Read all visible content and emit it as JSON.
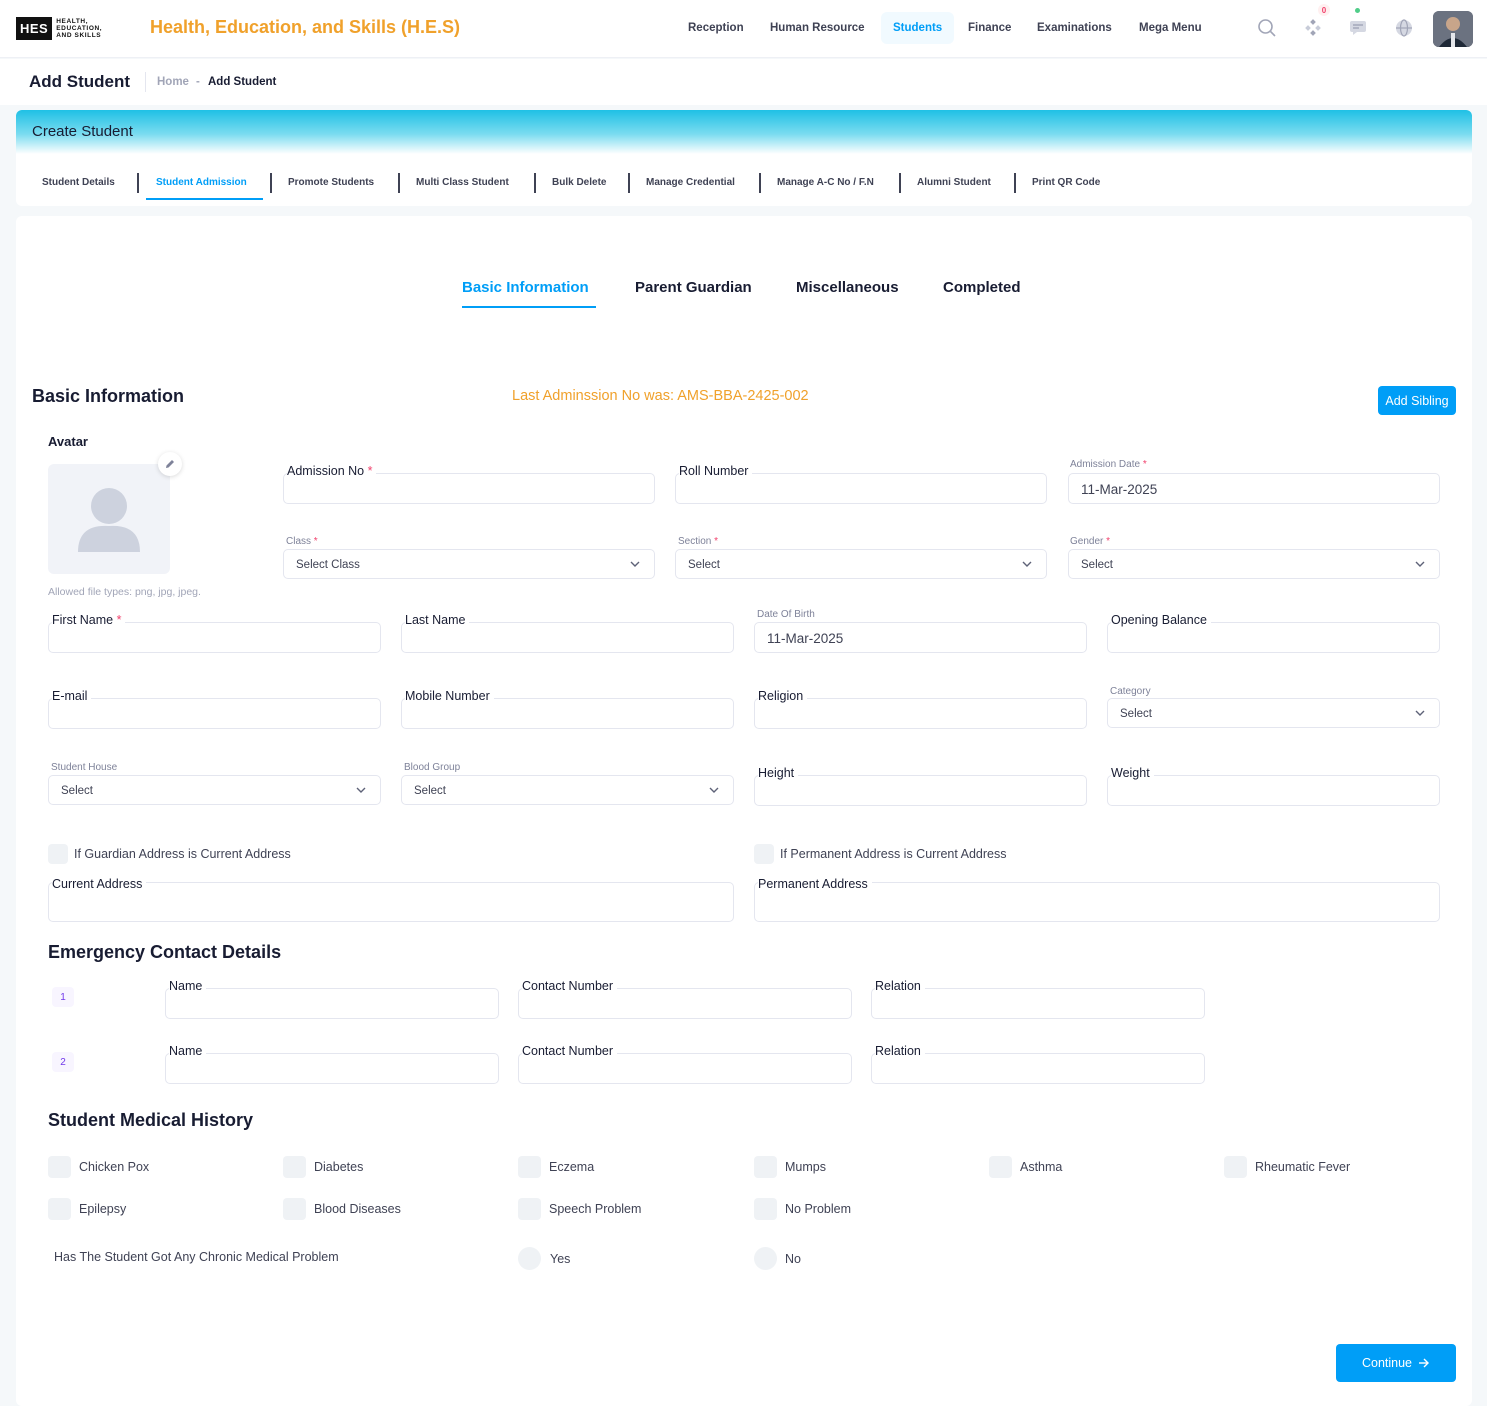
{
  "header": {
    "logo_mark": "HES",
    "logo_text": [
      "HEALTH,",
      "EDUCATION,",
      "AND SKILLS"
    ],
    "brand": "Health, Education, and Skills (H.E.S)",
    "nav": [
      "Reception",
      "Human Resource",
      "Students",
      "Finance",
      "Examinations",
      "Mega Menu"
    ],
    "active_nav": "Students",
    "notification_count": "0",
    "icons": [
      "search-icon",
      "apps-icon",
      "chat-icon",
      "globe-icon"
    ]
  },
  "subheader": {
    "title": "Add Student",
    "breadcrumb_home": "Home",
    "breadcrumb_sep": "-",
    "breadcrumb_current": "Add Student"
  },
  "card": {
    "title": "Create Student",
    "tabs": [
      "Student Details",
      "Student Admission",
      "Promote Students",
      "Multi Class Student",
      "Bulk Delete",
      "Manage Credential",
      "Manage A-C No / F.N",
      "Alumni Student",
      "Print QR Code"
    ],
    "active_tab": "Student Admission"
  },
  "stepper": {
    "steps": [
      "Basic Information",
      "Parent Guardian",
      "Miscellaneous",
      "Completed"
    ],
    "active": "Basic Information"
  },
  "basic": {
    "heading": "Basic Information",
    "last_admission": "Last Adminssion No was: AMS-BBA-2425-002",
    "add_sibling": "Add Sibling",
    "avatar_label": "Avatar",
    "allowed_types": "Allowed file types: png, jpg, jpeg.",
    "admission_no_label": "Admission No",
    "roll_number_label": "Roll Number",
    "admission_date_label": "Admission Date",
    "admission_date_value": "11-Mar-2025",
    "class_label": "Class",
    "class_value": "Select Class",
    "section_label": "Section",
    "section_value": "Select",
    "gender_label": "Gender",
    "gender_value": "Select",
    "first_name_label": "First Name",
    "last_name_label": "Last Name",
    "dob_label": "Date Of Birth",
    "dob_value": "11-Mar-2025",
    "opening_balance_label": "Opening Balance",
    "email_label": "E-mail",
    "mobile_label": "Mobile Number",
    "religion_label": "Religion",
    "category_label": "Category",
    "category_value": "Select",
    "house_label": "Student House",
    "house_value": "Select",
    "blood_label": "Blood Group",
    "blood_value": "Select",
    "height_label": "Height",
    "weight_label": "Weight",
    "guardian_addr_check": "If Guardian Address is Current Address",
    "permanent_addr_check": "If Permanent Address is Current Address",
    "current_address_label": "Current Address",
    "permanent_address_label": "Permanent Address",
    "required_mark": "*"
  },
  "emergency": {
    "heading": "Emergency Contact Details",
    "rows": [
      {
        "num": "1",
        "name_label": "Name",
        "contact_label": "Contact Number",
        "relation_label": "Relation"
      },
      {
        "num": "2",
        "name_label": "Name",
        "contact_label": "Contact Number",
        "relation_label": "Relation"
      }
    ]
  },
  "medical": {
    "heading": "Student Medical History",
    "conditions": [
      "Chicken Pox",
      "Diabetes",
      "Eczema",
      "Mumps",
      "Asthma",
      "Rheumatic Fever",
      "Epilepsy",
      "Blood Diseases",
      "Speech Problem",
      "No Problem"
    ],
    "chronic_question": "Has The Student Got Any Chronic Medical Problem",
    "yes": "Yes",
    "no": "No"
  },
  "footer": {
    "continue": "Continue"
  },
  "colors": {
    "primary": "#009ef7",
    "brand": "#f0a12b",
    "required": "#f1416c"
  }
}
